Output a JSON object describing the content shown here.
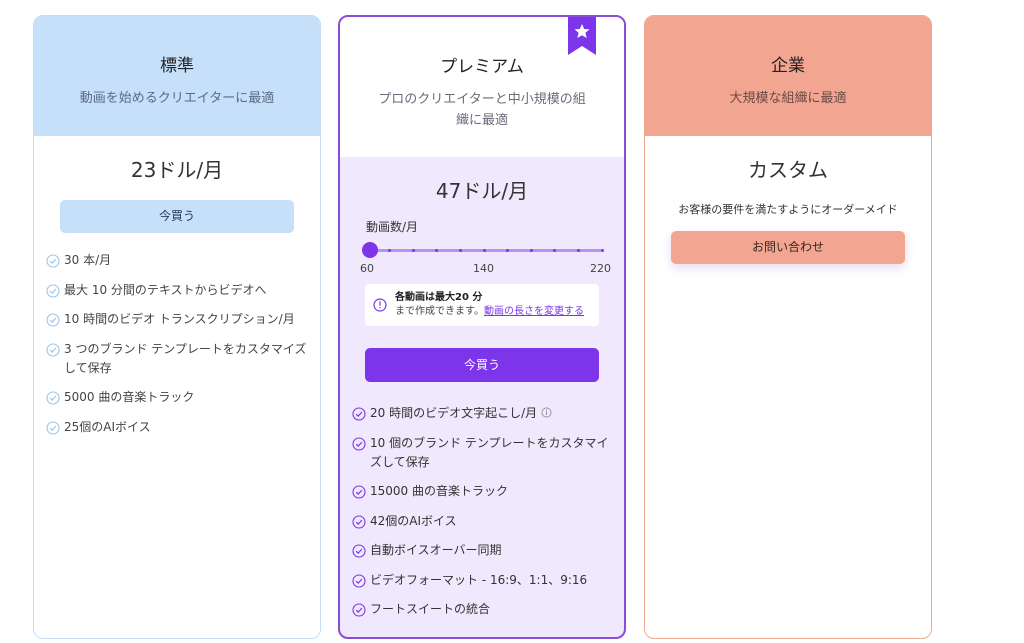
{
  "standard": {
    "name": "標準",
    "description": "動画を始めるクリエイターに最適",
    "price": "23ドル/月",
    "buy_label": "今買う",
    "features": [
      "30 本/月",
      "最大 10 分間のテキストからビデオへ",
      "10 時間のビデオ トランスクリプション/月",
      "3 つのブランド テンプレートをカスタマイズして保存",
      "5000 曲の音楽トラック",
      "25個のAIボイス"
    ]
  },
  "premium": {
    "name": "プレミアム",
    "description": "プロのクリエイターと中小規模の組織に最適",
    "price": "47ドル/月",
    "slider": {
      "label": "動画数/月",
      "min_label": "60",
      "mid_label": "140",
      "max_label": "220",
      "value": 60
    },
    "notice": {
      "line1": "各動画は最大20 分",
      "line2": "まで作成できます。",
      "link": "動画の長さを変更する"
    },
    "buy_label": "今買う",
    "features": [
      "20 時間のビデオ文字起こし/月",
      "10 個のブランド テンプレートをカスタマイズして保存",
      "15000 曲の音楽トラック",
      "42個のAIボイス",
      "自動ボイスオーバー同期",
      "ビデオフォーマット - 16:9、1:1、9:16",
      "フートスイートの統合"
    ]
  },
  "enterprise": {
    "name": "企業",
    "description": "大規模な組織に最適",
    "price": "カスタム",
    "detail": "お客様の要件を満たすようにオーダーメイド",
    "contact_label": "お問い合わせ"
  },
  "colors": {
    "standard_accent": "#c6e0fa",
    "premium_accent": "#7c35e8",
    "enterprise_accent": "#f2a691"
  },
  "icons": {
    "feature": "check-circle-icon",
    "ribbon": "star-ribbon-icon",
    "info": "info-circle-icon"
  }
}
